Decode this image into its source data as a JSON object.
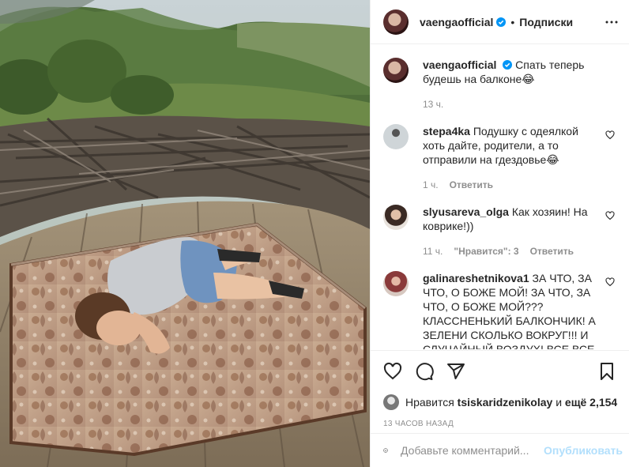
{
  "header": {
    "username": "vaengaofficial",
    "separator": "•",
    "follow_label": "Подписки"
  },
  "caption": {
    "username": "vaengaofficial",
    "text": "Спать теперь будешь на балконе😂",
    "time": "13 ч."
  },
  "comments": [
    {
      "username": "stepa4ka",
      "text": "Подушку с одеялкой хоть дайте, родители, а то отправили на гдездовье😂",
      "time": "1 ч.",
      "likes": "",
      "reply": "Ответить"
    },
    {
      "username": "slyusareva_olga",
      "text": "Как хозяин! На коврике!))",
      "time": "11 ч.",
      "likes": "\"Нравится\": 3",
      "reply": "Ответить"
    },
    {
      "username": "galinareshetnikova1",
      "text": "ЗА ЧТО, ЗА ЧТО, О БОЖЕ МОЙ! ЗА ЧТО, ЗА ЧТО, О БОЖЕ МОЙ??? КЛАССНЕНЬКИЙ БАЛКОНЧИК! А ЗЕЛЕНИ СКОЛЬКО ВОКРУГ!!! И СЛУЧАЙНЫЙ ВОЗДУХ! ВСЕ ВСЕ",
      "time": "",
      "likes": "",
      "reply": ""
    }
  ],
  "likes": {
    "prefix": "Нравится",
    "user": "tsiskaridzenikolay",
    "conj": "и",
    "more": "ещё 2,154"
  },
  "timestamp": "13 ЧАСОВ НАЗАД",
  "add_comment": {
    "placeholder": "Добавьте комментарий...",
    "post_label": "Опубликовать"
  },
  "icons": [
    "more-icon",
    "heart-icon",
    "comment-icon",
    "share-icon",
    "bookmark-icon",
    "emoji-icon",
    "verified-icon"
  ],
  "colors": {
    "verified": "#0095f6",
    "post_disabled": "#b2dffc",
    "secondary": "#8e8e8e"
  }
}
